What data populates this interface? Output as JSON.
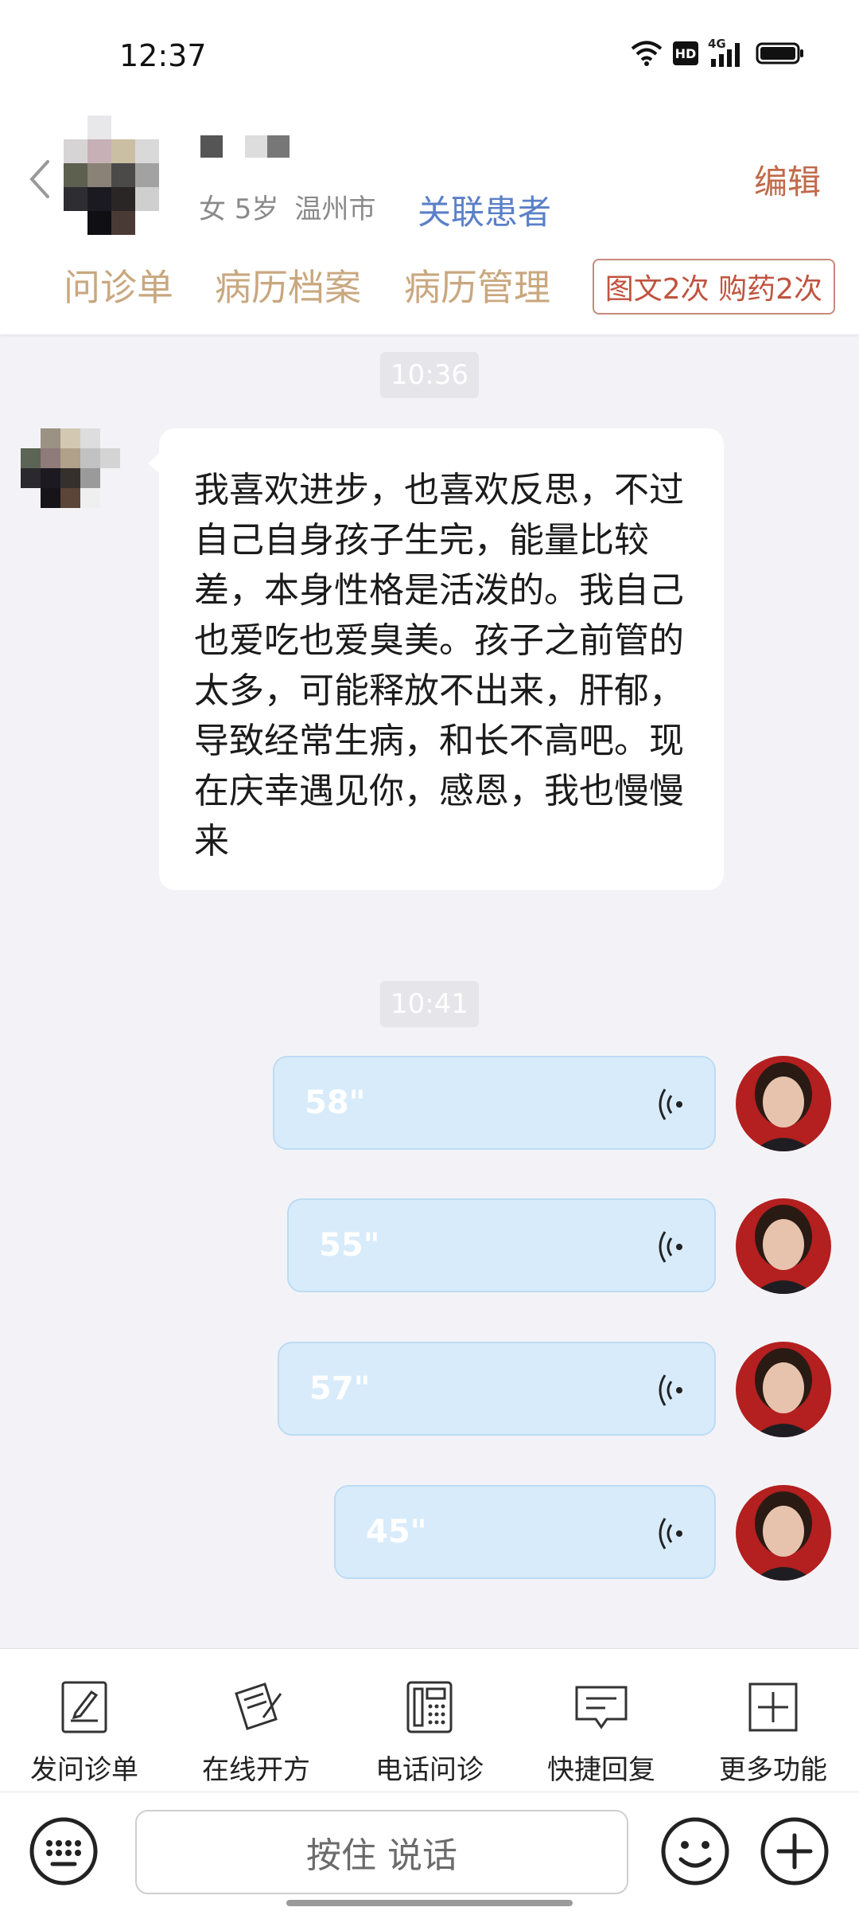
{
  "status_bar": {
    "time": "12:37",
    "icons": [
      "wifi-icon",
      "hd-icon",
      "4g-signal-icon",
      "battery-icon"
    ],
    "network_label": "4G",
    "hd_label": "HD"
  },
  "header": {
    "patient_info": "女 5岁",
    "patient_city": "温州市",
    "link_label": "关联患者",
    "edit_label": "编辑",
    "tabs": [
      "问诊单",
      "病历档案",
      "病历管理"
    ],
    "badge": "图文2次 购药2次"
  },
  "chat": {
    "messages": [
      {
        "type": "time",
        "text": "10:36"
      },
      {
        "type": "text",
        "sender": "patient",
        "text": "我喜欢进步，也喜欢反思，不过自己自身孩子生完，能量比较差，本身性格是活泼的。我自己也爱吃也爱臭美。孩子之前管的太多，可能释放不出来，肝郁，导致经常生病，和长不高吧。现在庆幸遇见你，感恩，我也慢慢来"
      },
      {
        "type": "time",
        "text": "10:41"
      },
      {
        "type": "voice",
        "sender": "doctor",
        "duration": "58\""
      },
      {
        "type": "voice",
        "sender": "doctor",
        "duration": "55\""
      },
      {
        "type": "voice",
        "sender": "doctor",
        "duration": "57\""
      },
      {
        "type": "voice",
        "sender": "doctor",
        "duration": "45\""
      }
    ]
  },
  "toolbar": {
    "items": [
      {
        "label": "发问诊单",
        "icon": "form-edit-icon"
      },
      {
        "label": "在线开方",
        "icon": "prescription-icon"
      },
      {
        "label": "电话问诊",
        "icon": "phone-icon"
      },
      {
        "label": "快捷回复",
        "icon": "quick-reply-icon"
      },
      {
        "label": "更多功能",
        "icon": "more-plus-icon"
      }
    ]
  },
  "input_bar": {
    "hold_to_talk": "按住 说话"
  },
  "colors": {
    "accent_link": "#5b80c8",
    "edit": "#c06a4a",
    "tab": "#c9a880",
    "badge": "#c0533f",
    "voice_bubble": "#d8ebfa"
  }
}
